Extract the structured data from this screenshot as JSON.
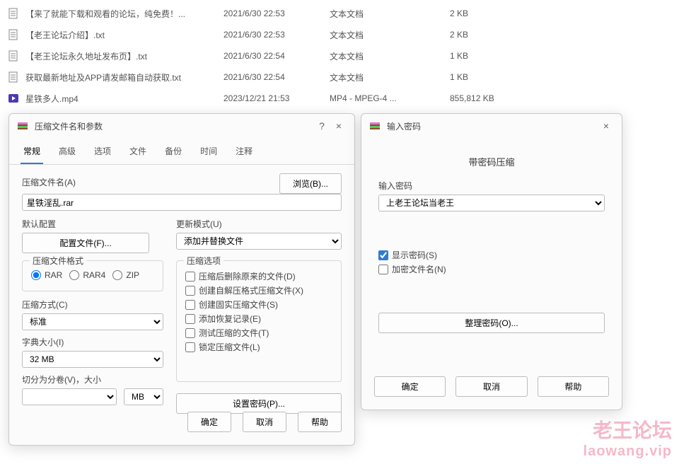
{
  "files": [
    {
      "name": "【来了就能下载和观看的论坛，纯免费！...",
      "date": "2021/6/30 22:53",
      "type": "文本文档",
      "size": "2 KB",
      "icon": "text"
    },
    {
      "name": "【老王论坛介绍】.txt",
      "date": "2021/6/30 22:53",
      "type": "文本文档",
      "size": "2 KB",
      "icon": "text"
    },
    {
      "name": "【老王论坛永久地址发布页】.txt",
      "date": "2021/6/30 22:54",
      "type": "文本文档",
      "size": "1 KB",
      "icon": "text"
    },
    {
      "name": "获取最新地址及APP请发邮箱自动获取.txt",
      "date": "2021/6/30 22:54",
      "type": "文本文档",
      "size": "1 KB",
      "icon": "text"
    },
    {
      "name": "星铁多人.mp4",
      "date": "2023/12/21 21:53",
      "type": "MP4 - MPEG-4 ...",
      "size": "855,812 KB",
      "icon": "video"
    }
  ],
  "dialog1": {
    "title": "压缩文件名和参数",
    "help": "?",
    "close": "×",
    "tabs": [
      "常规",
      "高级",
      "选项",
      "文件",
      "备份",
      "时间",
      "注释"
    ],
    "archive_name_label": "压缩文件名(A)",
    "archive_name_value": "星铁淫乱.rar",
    "browse": "浏览(B)...",
    "default_profile_label": "默认配置",
    "profiles_btn": "配置文件(F)...",
    "update_mode_label": "更新模式(U)",
    "update_mode_value": "添加并替换文件",
    "format_label": "压缩文件格式",
    "fmt_rar": "RAR",
    "fmt_rar4": "RAR4",
    "fmt_zip": "ZIP",
    "method_label": "压缩方式(C)",
    "method_value": "标准",
    "dict_label": "字典大小(I)",
    "dict_value": "32 MB",
    "split_label": "切分为分卷(V)，大小",
    "split_unit": "MB",
    "options_label": "压缩选项",
    "opt_delete": "压缩后删除原来的文件(D)",
    "opt_sfx": "创建自解压格式压缩文件(X)",
    "opt_solid": "创建固实压缩文件(S)",
    "opt_recovery": "添加恢复记录(E)",
    "opt_test": "测试压缩的文件(T)",
    "opt_lock": "锁定压缩文件(L)",
    "set_password": "设置密码(P)...",
    "ok": "确定",
    "cancel": "取消",
    "help_btn": "帮助"
  },
  "dialog2": {
    "title": "输入密码",
    "close": "×",
    "subtitle": "带密码压缩",
    "pw_label": "输入密码",
    "pw_value": "上老王论坛当老王",
    "show_pw": "显示密码(S)",
    "encrypt_names": "加密文件名(N)",
    "manage": "整理密码(O)...",
    "ok": "确定",
    "cancel": "取消",
    "help_btn": "帮助"
  },
  "watermark": {
    "line1": "老王论坛",
    "line2": "laowang.vip"
  }
}
